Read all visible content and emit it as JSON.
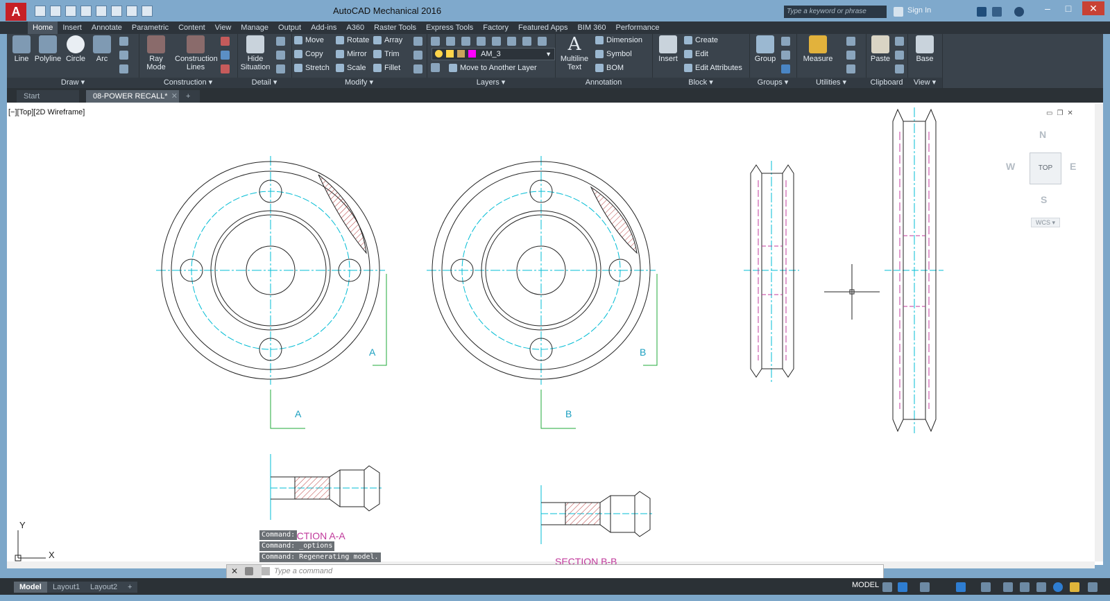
{
  "titlebar": {
    "app_letter": "A",
    "title": "AutoCAD Mechanical 2016",
    "search_placeholder": "Type a keyword or phrase",
    "signin": "Sign In",
    "minimize": "–",
    "maximize": "□",
    "close": "✕"
  },
  "ribbon_tabs": [
    "Home",
    "Insert",
    "Annotate",
    "Parametric",
    "Content",
    "View",
    "Manage",
    "Output",
    "Add-ins",
    "A360",
    "Raster Tools",
    "Express Tools",
    "Factory",
    "Featured Apps",
    "BIM 360",
    "Performance"
  ],
  "ribbon": {
    "draw": {
      "title": "Draw ▾",
      "line": "Line",
      "polyline": "Polyline",
      "circle": "Circle",
      "arc": "Arc"
    },
    "construction": {
      "title": "Construction ▾",
      "ray_mode": "Ray Mode",
      "construction_lines": "Construction Lines"
    },
    "detail": {
      "title": "Detail ▾",
      "hide_situation": "Hide Situation"
    },
    "modify": {
      "title": "Modify ▾",
      "move": "Move",
      "rotate": "Rotate",
      "array": "Array",
      "copy": "Copy",
      "mirror": "Mirror",
      "trim": "Trim",
      "stretch": "Stretch",
      "scale": "Scale",
      "fillet": "Fillet"
    },
    "layers": {
      "title": "Layers ▾",
      "current_layer": "AM_3",
      "move_to_layer": "Move to Another Layer"
    },
    "annotation": {
      "title": "Annotation",
      "multiline_text": "Multiline Text",
      "dimension": "Dimension",
      "symbol": "Symbol",
      "bom": "BOM"
    },
    "block": {
      "title": "Block ▾",
      "insert": "Insert",
      "create": "Create",
      "edit": "Edit",
      "edit_attributes": "Edit Attributes"
    },
    "groups": {
      "title": "Groups ▾",
      "group": "Group"
    },
    "utilities": {
      "title": "Utilities ▾",
      "measure": "Measure"
    },
    "clipboard": {
      "title": "Clipboard",
      "paste": "Paste"
    },
    "view": {
      "title": "View ▾",
      "base": "Base"
    }
  },
  "file_tabs": {
    "start": "Start",
    "doc": "08-POWER RECALL*",
    "close": "✕",
    "new": "+"
  },
  "viewport": {
    "label": "[−][Top][2D Wireframe]"
  },
  "viewcube": {
    "n": "N",
    "s": "S",
    "e": "E",
    "w": "W",
    "top": "TOP",
    "wcs": "WCS ▾"
  },
  "drawing": {
    "cut_a": "A",
    "cut_b": "B",
    "section_a": "SECTION A-A",
    "section_b": "SECTION B-B",
    "ucs_x": "X",
    "ucs_y": "Y"
  },
  "command": {
    "history": [
      "Command:",
      "Command: _options",
      "Command: Regenerating model."
    ],
    "placeholder": "Type a command"
  },
  "status": {
    "layouts": [
      "Model",
      "Layout1",
      "Layout2"
    ],
    "add": "+",
    "model": "MODEL"
  }
}
